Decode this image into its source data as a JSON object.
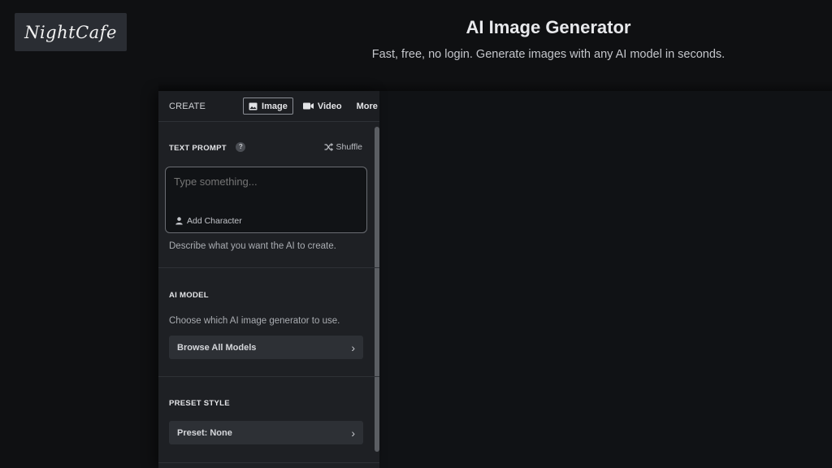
{
  "brand": {
    "logo_text": "NightCafe"
  },
  "header": {
    "title": "AI Image Generator",
    "subtitle": "Fast, free, no login. Generate images with any AI model in seconds."
  },
  "panel": {
    "create_label": "CREATE",
    "tabs": [
      {
        "label": "Image",
        "icon": "image-icon",
        "active": true
      },
      {
        "label": "Video",
        "icon": "video-icon",
        "active": false
      },
      {
        "label": "More",
        "icon": "up-down-chevron-icon",
        "active": false
      }
    ]
  },
  "prompt": {
    "title": "TEXT PROMPT",
    "help": "?",
    "shuffle_label": "Shuffle",
    "placeholder": "Type something...",
    "add_character": "Add Character",
    "helper": "Describe what you want the AI to create."
  },
  "model": {
    "title": "AI MODEL",
    "description": "Choose which AI image generator to use.",
    "button_label": "Browse All Models"
  },
  "style": {
    "title": "PRESET STYLE",
    "button_label": "Preset: None"
  }
}
